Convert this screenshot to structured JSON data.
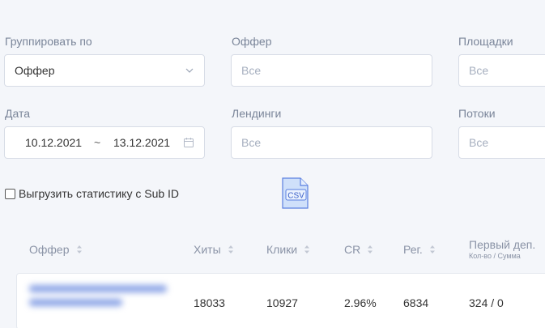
{
  "filters": {
    "group_by": {
      "label": "Группировать по",
      "value": "Оффер"
    },
    "offer": {
      "label": "Оффер",
      "placeholder": "Все"
    },
    "platforms": {
      "label": "Площадки",
      "placeholder": "Все"
    },
    "date": {
      "label": "Дата",
      "from": "10.12.2021",
      "separator": "~",
      "to": "13.12.2021"
    },
    "landings": {
      "label": "Лендинги",
      "placeholder": "Все"
    },
    "streams": {
      "label": "Потоки",
      "placeholder": "Все"
    }
  },
  "export": {
    "checkbox_label": "Выгрузить статистику с Sub ID",
    "csv_label": "CSV",
    "checked": false
  },
  "table": {
    "columns": [
      "Оффер",
      "Хиты",
      "Клики",
      "CR",
      "Рег.",
      "Первый деп."
    ],
    "first_dep_sub": "Кол-во / Сумма",
    "rows": [
      {
        "hits": "18033",
        "clicks": "10927",
        "cr": "2.96%",
        "reg": "6834",
        "first_dep": "324 / 0"
      }
    ]
  },
  "colors": {
    "accent": "#5b7fe0",
    "muted_text": "#7a8599",
    "border": "#d7dce6"
  }
}
